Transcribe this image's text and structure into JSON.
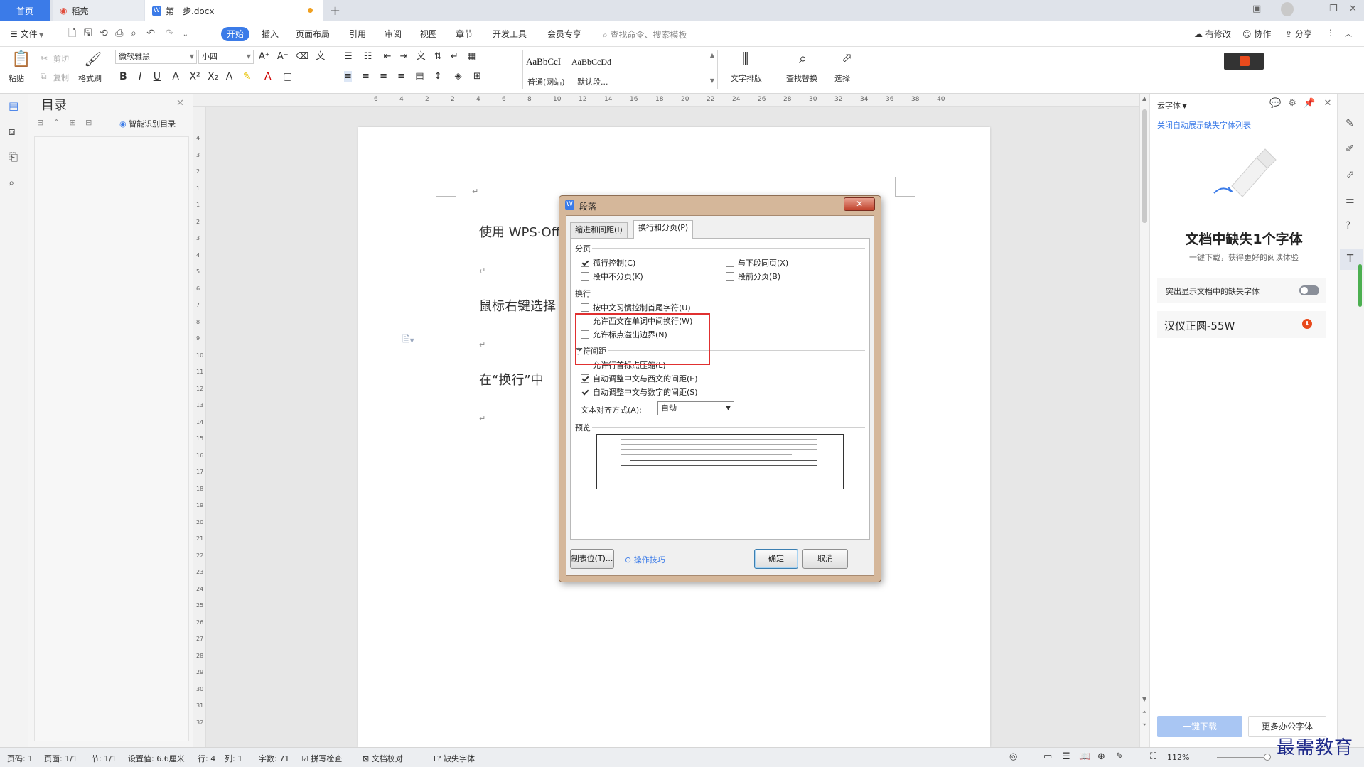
{
  "tabs": {
    "home": "首页",
    "daoke": "稻壳",
    "doc": "第一步.docx",
    "plus": "+"
  },
  "menu": {
    "file": "文件",
    "items": [
      "开始",
      "插入",
      "页面布局",
      "引用",
      "审阅",
      "视图",
      "章节",
      "开发工具",
      "会员专享"
    ],
    "search": "查找命令、搜索模板",
    "modified": "有修改",
    "collab": "协作",
    "share": "分享"
  },
  "ribbon": {
    "paste": "粘贴",
    "cut": "剪切",
    "copy": "复制",
    "format_painter": "格式刷",
    "font_name": "微软雅黑",
    "font_size": "小四",
    "style1_preview": "AaBbCcI",
    "style1_name": "普通(网站)",
    "style2_preview": "AaBbCcDd",
    "style2_name": "默认段...",
    "text_layout": "文字排版",
    "find_replace": "查找替换",
    "select": "选择"
  },
  "toc": {
    "title": "目录",
    "smart": "智能识别目录"
  },
  "ruler": {
    "h_ticks": [
      "6",
      "4",
      "2",
      "2",
      "4",
      "6",
      "8",
      "10",
      "12",
      "14",
      "16",
      "18",
      "20",
      "22",
      "24",
      "26",
      "28",
      "30",
      "32",
      "34",
      "36",
      "38",
      "40"
    ],
    "v_ticks": [
      "4",
      "3",
      "2",
      "1",
      "1",
      "2",
      "3",
      "4",
      "5",
      "6",
      "7",
      "8",
      "9",
      "10",
      "11",
      "12",
      "13",
      "14",
      "15",
      "16",
      "17",
      "18",
      "19",
      "20",
      "21",
      "22",
      "23",
      "24",
      "25",
      "26",
      "27",
      "28",
      "29",
      "30",
      "31",
      "32"
    ]
  },
  "document": {
    "line1": "使用 WPS·Off",
    "line2": "鼠标右键选择",
    "line3": "在“换行”中",
    "para_mark": "↵"
  },
  "dialog": {
    "title": "段落",
    "close": "✕",
    "tab_indent": "缩进和间距(I)",
    "tab_linebreak": "换行和分页(P)",
    "section_pagination": "分页",
    "widow_control": "孤行控制(C)",
    "keep_with_next": "与下段同页(X)",
    "keep_lines": "段中不分页(K)",
    "page_break_before": "段前分页(B)",
    "section_linebreak": "换行",
    "cn_rules": "按中文习惯控制首尾字符(U)",
    "allow_word_break": "允许西文在单词中间换行(W)",
    "allow_punct_overflow": "允许标点溢出边界(N)",
    "section_spacing": "字符间距",
    "compress_punct": "允许行首标点压缩(L)",
    "auto_cn_en": "自动调整中文与西文的间距(E)",
    "auto_cn_num": "自动调整中文与数字的间距(S)",
    "text_align_label": "文本对齐方式(A):",
    "text_align_value": "自动",
    "section_preview": "预览",
    "tabs_button": "制表位(T)...",
    "tips": "操作技巧",
    "ok": "确定",
    "cancel": "取消",
    "checks": {
      "widow_control": true,
      "keep_with_next": false,
      "keep_lines": false,
      "page_break_before": false,
      "cn_rules": false,
      "allow_word_break": false,
      "allow_punct_overflow": false,
      "compress_punct": false,
      "auto_cn_en": true,
      "auto_cn_num": true
    }
  },
  "rightpanel": {
    "title": "云字体",
    "link": "关闭自动展示缺失字体列表",
    "headline": "文档中缺失1个字体",
    "subline": "一键下载，获得更好的阅读体验",
    "toggle_label": "突出显示文档中的缺失字体",
    "font_item": "汉仪正圆-55W",
    "download": "一键下载",
    "more_fonts": "更多办公字体"
  },
  "status": {
    "page_num": "页码: 1",
    "page": "页面: 1/1",
    "section": "节: 1/1",
    "setting": "设置值: 6.6厘米",
    "row": "行: 4",
    "col": "列: 1",
    "words": "字数: 71",
    "spell": "拼写检查",
    "proof": "文档校对",
    "missing_font": "缺失字体",
    "zoom": "112%"
  },
  "watermark": "最需教育",
  "colors": {
    "accent": "#3b7be8",
    "highlight": "#e03030",
    "dialog_frame": "#d5b79a"
  }
}
